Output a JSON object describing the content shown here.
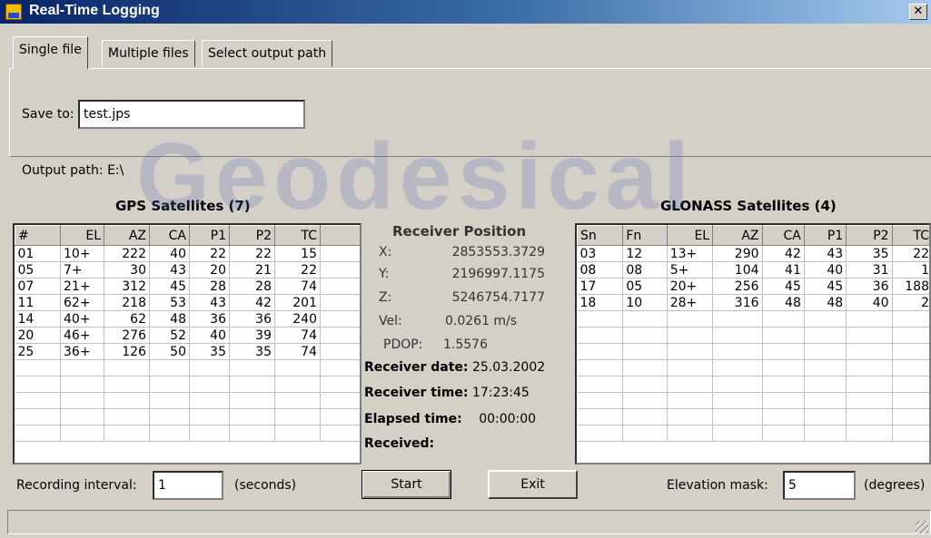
{
  "window": {
    "title": "Real-Time Logging",
    "close_glyph": "✕"
  },
  "tabs": [
    {
      "label": "Single file",
      "active": true
    },
    {
      "label": "Multiple files",
      "active": false
    },
    {
      "label": "Select output path",
      "active": false
    }
  ],
  "save": {
    "label": "Save to:",
    "value": "test.jps"
  },
  "output_path": "Output path: E:\\",
  "watermark": "Geodesical",
  "gps": {
    "title": "GPS Satellites (7)",
    "columns": [
      "#",
      "EL",
      "AZ",
      "CA",
      "P1",
      "P2",
      "TC"
    ],
    "rows": [
      [
        "01",
        "10+",
        "222",
        "40",
        "22",
        "22",
        "15"
      ],
      [
        "05",
        "7+",
        "30",
        "43",
        "20",
        "21",
        "22"
      ],
      [
        "07",
        "21+",
        "312",
        "45",
        "28",
        "28",
        "74"
      ],
      [
        "11",
        "62+",
        "218",
        "53",
        "43",
        "42",
        "201"
      ],
      [
        "14",
        "40+",
        "62",
        "48",
        "36",
        "36",
        "240"
      ],
      [
        "20",
        "46+",
        "276",
        "52",
        "40",
        "39",
        "74"
      ],
      [
        "25",
        "36+",
        "126",
        "50",
        "35",
        "35",
        "74"
      ]
    ]
  },
  "glonass": {
    "title": "GLONASS Satellites (4)",
    "columns": [
      "Sn",
      "Fn",
      "EL",
      "AZ",
      "CA",
      "P1",
      "P2",
      "TC"
    ],
    "rows": [
      [
        "03",
        "12",
        "13+",
        "290",
        "42",
        "43",
        "35",
        "22"
      ],
      [
        "08",
        "08",
        "5+",
        "104",
        "41",
        "40",
        "31",
        "1"
      ],
      [
        "17",
        "05",
        "20+",
        "256",
        "45",
        "45",
        "36",
        "188"
      ],
      [
        "18",
        "10",
        "28+",
        "316",
        "48",
        "48",
        "40",
        "2"
      ]
    ]
  },
  "receiver": {
    "title": "Receiver Position",
    "x_label": "X:",
    "x": "2853553.3729",
    "y_label": "Y:",
    "y": "2196997.1175",
    "z_label": "Z:",
    "z": "5246754.7177",
    "vel_label": "Vel:",
    "vel": "0.0261 m/s",
    "pdop_label": "PDOP:",
    "pdop": "1.5576",
    "date_label": "Receiver date:",
    "date": "25.03.2002",
    "time_label": "Receiver time:",
    "time": "17:23:45",
    "elapsed_label": "Elapsed time:",
    "elapsed": "00:00:00",
    "received_label": "Received:"
  },
  "recording": {
    "label": "Recording interval:",
    "value": "1",
    "unit": "(seconds)"
  },
  "buttons": {
    "start": "Start",
    "exit": "Exit"
  },
  "elevation": {
    "label": "Elevation mask:",
    "value": "5",
    "unit": "(degrees)"
  }
}
